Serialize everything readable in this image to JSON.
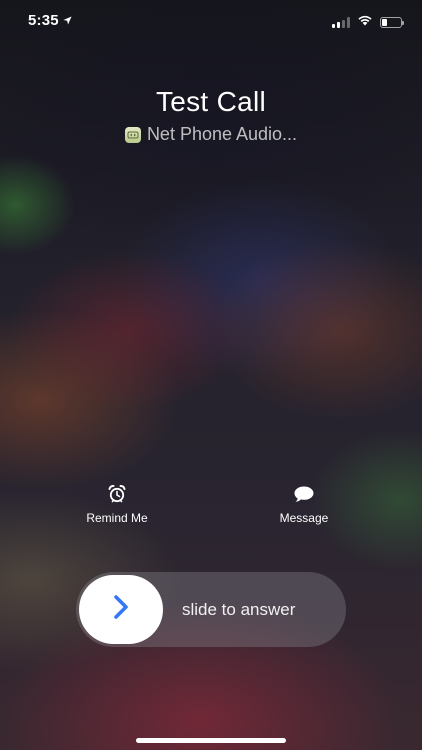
{
  "status_bar": {
    "time": "5:35",
    "battery_level": 0.3,
    "signal_bars_active": 2,
    "signal_bars_total": 4,
    "icons": [
      "location-arrow-icon",
      "cellular-signal-icon",
      "wifi-icon",
      "battery-icon"
    ]
  },
  "caller": {
    "name": "Test Call",
    "subtitle": "Net Phone Audio...",
    "app_icon": "net-phone-app-icon"
  },
  "actions": {
    "remind_label": "Remind Me",
    "remind_icon": "alarm-clock-icon",
    "message_label": "Message",
    "message_icon": "speech-bubble-icon"
  },
  "slider": {
    "label": "slide to answer",
    "knob_icon": "chevron-right-icon",
    "accent": "#3478f6"
  }
}
